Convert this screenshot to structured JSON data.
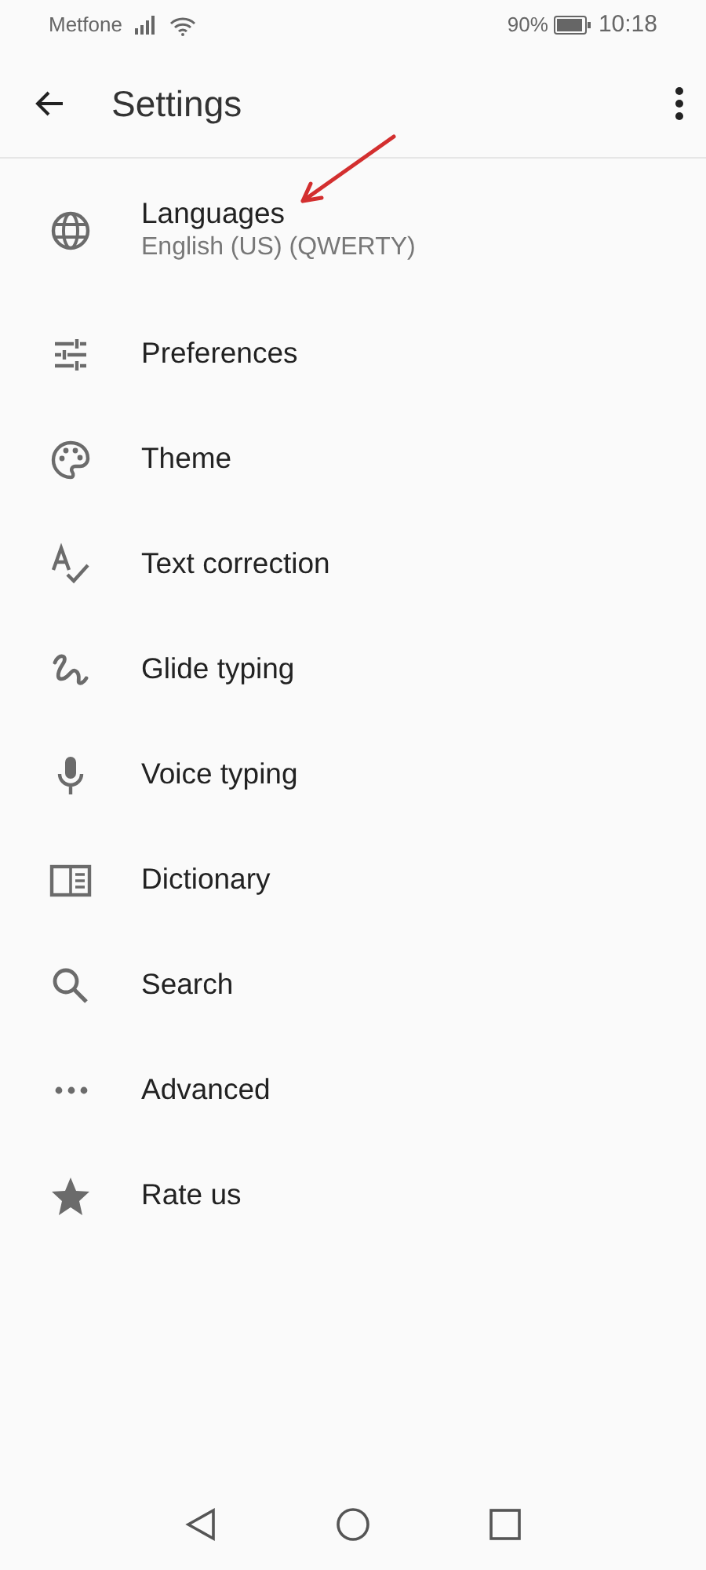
{
  "status_bar": {
    "carrier": "Metfone",
    "battery": "90%",
    "time": "10:18"
  },
  "app_bar": {
    "title": "Settings"
  },
  "items": [
    {
      "label": "Languages",
      "summary": "English (US) (QWERTY)"
    },
    {
      "label": "Preferences"
    },
    {
      "label": "Theme"
    },
    {
      "label": "Text correction"
    },
    {
      "label": "Glide typing"
    },
    {
      "label": "Voice typing"
    },
    {
      "label": "Dictionary"
    },
    {
      "label": "Search"
    },
    {
      "label": "Advanced"
    },
    {
      "label": "Rate us"
    }
  ]
}
